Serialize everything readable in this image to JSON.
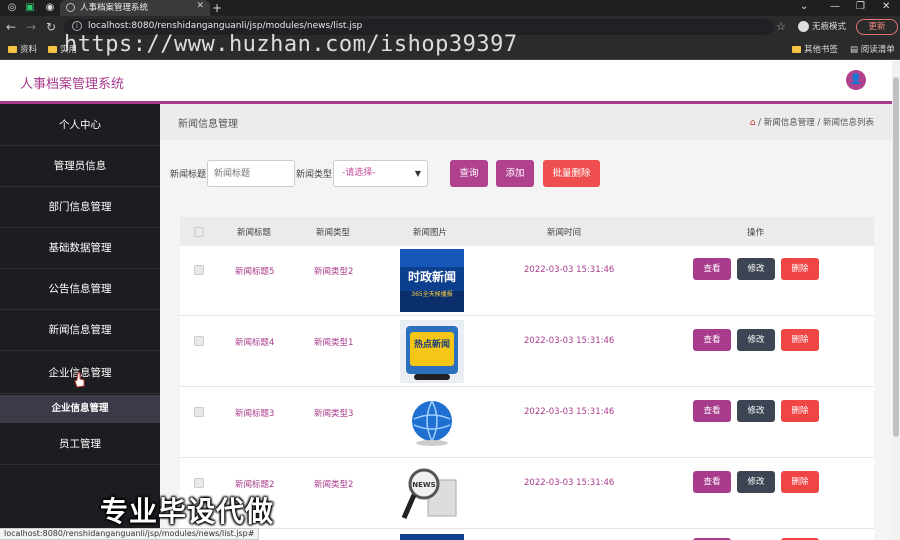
{
  "browser": {
    "tab_title": "人事档案管理系统",
    "url": "localhost:8080/renshidanganguanli/jsp/modules/news/list.jsp",
    "incognito_label": "无痕模式",
    "update_label": "更新",
    "bookmarks": [
      "资料",
      "实用"
    ],
    "bookmarks_right": [
      "其他书签",
      "阅读清单"
    ],
    "status_url": "localhost:8080/renshidanganguanli/jsp/modules/news/list.jsp#"
  },
  "watermark_top": "https://www.huzhan.com/ishop39397",
  "watermark_bottom": "专业毕设代做",
  "app": {
    "title": "人事档案管理系统",
    "accent": "#a83b8c"
  },
  "sidebar": {
    "items": [
      "个人中心",
      "管理员信息",
      "部门信息管理",
      "基础数据管理",
      "公告信息管理",
      "新闻信息管理",
      "企业信息管理",
      "员工管理"
    ],
    "sub_item": "企业信息管理"
  },
  "page": {
    "title": "新闻信息管理",
    "breadcrumb": [
      "新闻信息管理",
      "新闻信息列表"
    ]
  },
  "search": {
    "title_label": "新闻标题",
    "title_placeholder": "新闻标题",
    "type_label": "新闻类型",
    "type_value": "-请选择-",
    "query_button": "查询",
    "add_button": "添加",
    "batch_delete_button": "批量删除"
  },
  "table": {
    "headers": [
      "新闻标题",
      "新闻类型",
      "新闻图片",
      "新闻时间",
      "操作"
    ],
    "rows": [
      {
        "title": "新闻标题5",
        "type": "新闻类型2",
        "time": "2022-03-03 15:31:46",
        "image": "news-image-shizheng",
        "image_text": "时政新闻",
        "image_sub": "365全天候播报"
      },
      {
        "title": "新闻标题4",
        "type": "新闻类型1",
        "time": "2022-03-03 15:31:46",
        "image": "news-image-redian",
        "image_text": "热点新闻",
        "image_sub": ""
      },
      {
        "title": "新闻标题3",
        "type": "新闻类型3",
        "time": "2022-03-03 15:31:46",
        "image": "news-image-globe",
        "image_text": "",
        "image_sub": ""
      },
      {
        "title": "新闻标题2",
        "type": "新闻类型2",
        "time": "2022-03-03 15:31:46",
        "image": "news-image-magnifier",
        "image_text": "NEWS",
        "image_sub": ""
      }
    ],
    "actions": {
      "view": "查看",
      "edit": "修改",
      "delete": "删除"
    }
  }
}
